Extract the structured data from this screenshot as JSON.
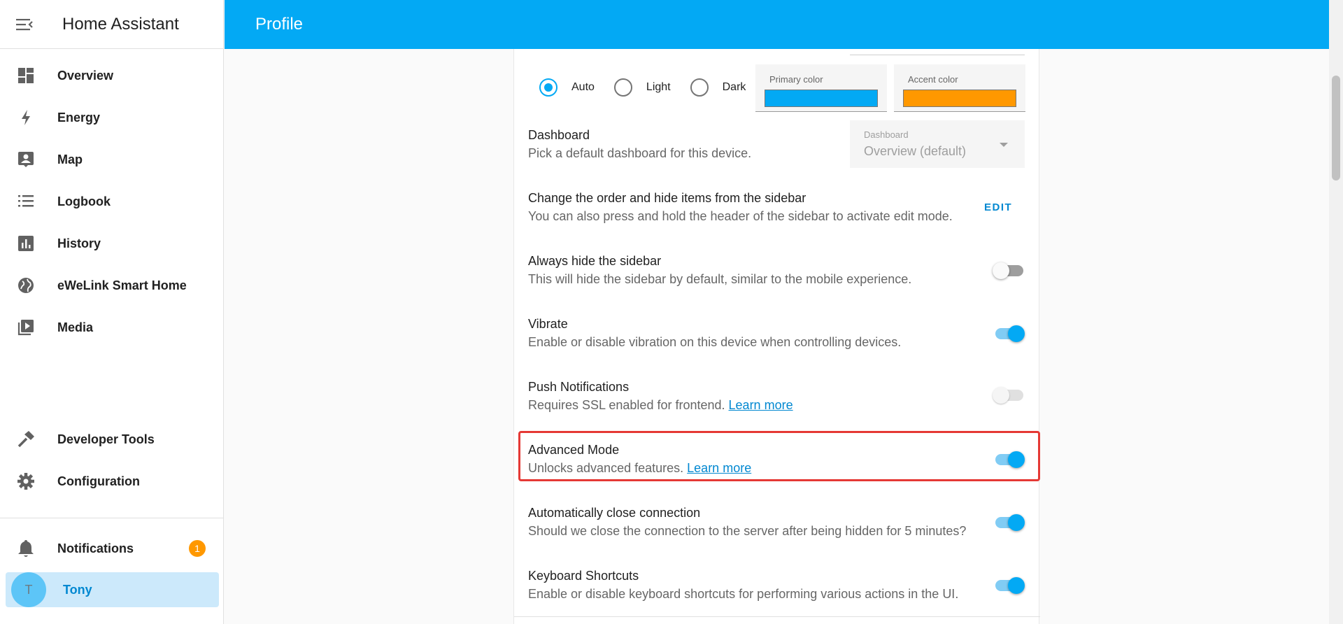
{
  "sidebar": {
    "title": "Home Assistant",
    "items": [
      {
        "label": "Overview",
        "icon": "overview-icon"
      },
      {
        "label": "Energy",
        "icon": "lightning-icon"
      },
      {
        "label": "Map",
        "icon": "map-icon"
      },
      {
        "label": "Logbook",
        "icon": "logbook-icon"
      },
      {
        "label": "History",
        "icon": "history-icon"
      },
      {
        "label": "eWeLink Smart Home",
        "icon": "globe-icon"
      },
      {
        "label": "Media",
        "icon": "media-icon"
      }
    ],
    "bottom_items": [
      {
        "label": "Developer Tools",
        "icon": "hammer-icon"
      },
      {
        "label": "Configuration",
        "icon": "gear-icon"
      }
    ],
    "notifications": {
      "label": "Notifications",
      "count": "1"
    },
    "user": {
      "initial": "T",
      "name": "Tony"
    }
  },
  "header": {
    "title": "Profile"
  },
  "theme": {
    "options": [
      {
        "label": "Auto",
        "selected": true
      },
      {
        "label": "Light",
        "selected": false
      },
      {
        "label": "Dark",
        "selected": false
      }
    ],
    "primary_color_label": "Primary color",
    "primary_color": "#03a9f4",
    "accent_color_label": "Accent color",
    "accent_color": "#ff9800"
  },
  "dashboard": {
    "title": "Dashboard",
    "description": "Pick a default dashboard for this device.",
    "select_label": "Dashboard",
    "select_value": "Overview (default)"
  },
  "sidebar_order": {
    "title": "Change the order and hide items from the sidebar",
    "description": "You can also press and hold the header of the sidebar to activate edit mode.",
    "button_label": "EDIT"
  },
  "settings": [
    {
      "title": "Always hide the sidebar",
      "description": "This will hide the sidebar by default, similar to the mobile experience.",
      "link": "",
      "state": "off"
    },
    {
      "title": "Vibrate",
      "description": "Enable or disable vibration on this device when controlling devices.",
      "link": "",
      "state": "on"
    },
    {
      "title": "Push Notifications",
      "description": "Requires SSL enabled for frontend.",
      "link": "Learn more",
      "state": "disabled"
    },
    {
      "title": "Advanced Mode",
      "description": "Unlocks advanced features.",
      "link": "Learn more",
      "state": "on"
    },
    {
      "title": "Automatically close connection",
      "description": "Should we close the connection to the server after being hidden for 5 minutes?",
      "link": "",
      "state": "on"
    },
    {
      "title": "Keyboard Shortcuts",
      "description": "Enable or disable keyboard shortcuts for performing various actions in the UI.",
      "link": "",
      "state": "on"
    }
  ],
  "colors": {
    "brand": "#03a9f4",
    "highlight": "#e53935",
    "badge": "#ff9800"
  }
}
